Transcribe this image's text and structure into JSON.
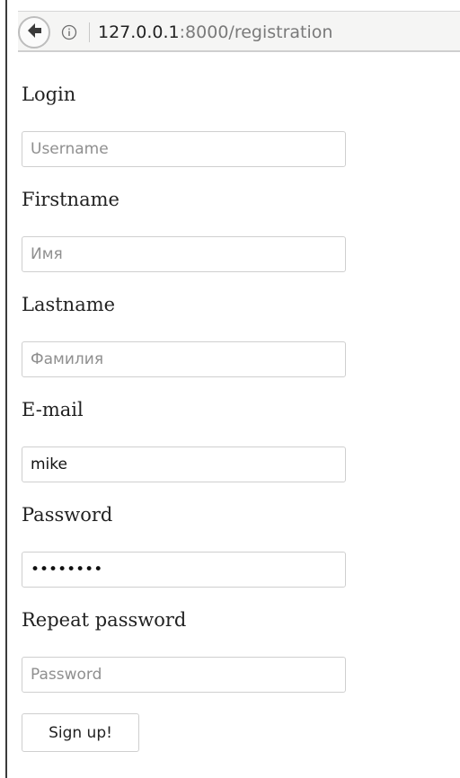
{
  "browser": {
    "url_host": "127.0.0.1",
    "url_rest": ":8000/registration",
    "back_icon": "arrow-left-icon",
    "info_icon": "info-circle-icon"
  },
  "form": {
    "fields": [
      {
        "label": "Login",
        "placeholder": "Username",
        "value": "",
        "type": "text"
      },
      {
        "label": "Firstname",
        "placeholder": "Имя",
        "value": "",
        "type": "text"
      },
      {
        "label": "Lastname",
        "placeholder": "Фамилия",
        "value": "",
        "type": "text"
      },
      {
        "label": "E-mail",
        "placeholder": "",
        "value": "mike",
        "type": "text"
      },
      {
        "label": "Password",
        "placeholder": "",
        "value": "password",
        "type": "password"
      },
      {
        "label": "Repeat password",
        "placeholder": "Password",
        "value": "",
        "type": "password"
      }
    ],
    "submit_label": "Sign up!"
  }
}
